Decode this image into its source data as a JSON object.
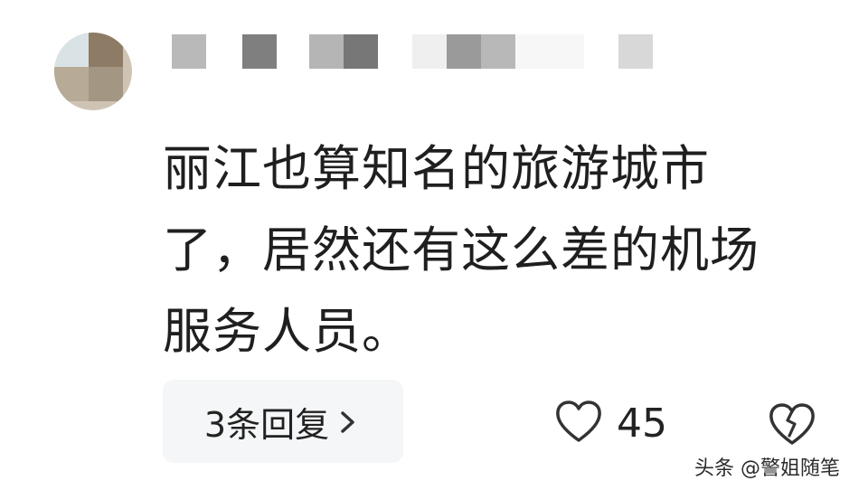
{
  "comment": {
    "text": "丽江也算知名的旅游城市\n了，居然还有这么差的机场\n服务人员。"
  },
  "actions": {
    "reply_label": "3条回复",
    "reply_chevron_icon": "chevron-right-icon",
    "like_icon": "heart-outline-icon",
    "like_count": "45",
    "dislike_icon": "broken-heart-icon"
  },
  "watermark": {
    "text": "头条 @警姐随笔"
  },
  "colors": {
    "text": "#222222",
    "reply_bg": "#f5f6f7",
    "icon_stroke": "#333333"
  }
}
